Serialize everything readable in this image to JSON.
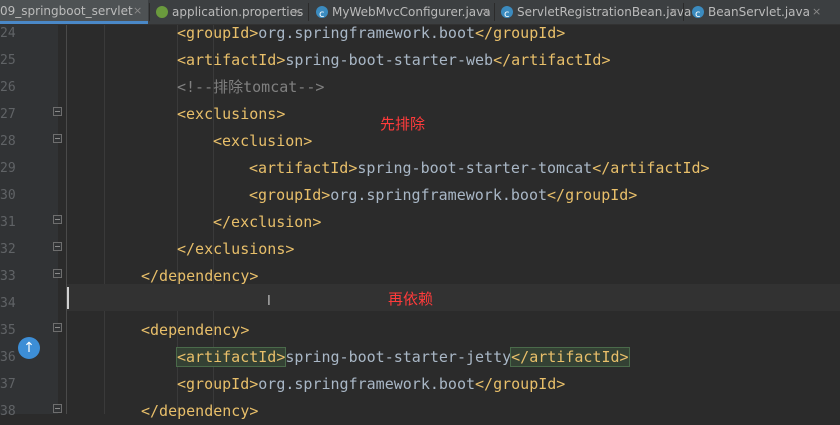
{
  "tabs": [
    {
      "label": "09_springboot_servlet",
      "icon": "module-icon",
      "active": true
    },
    {
      "label": "application.properties",
      "icon": "spring-leaf-icon"
    },
    {
      "label": "MyWebMvcConfigurer.java",
      "icon": "class-icon"
    },
    {
      "label": "ServletRegistrationBean.java",
      "icon": "class-icon"
    },
    {
      "label": "BeanServlet.java",
      "icon": "class-icon"
    }
  ],
  "close_glyph": "×",
  "gutter": {
    "line_numbers": [
      "24",
      "25",
      "26",
      "27",
      "28",
      "29",
      "30",
      "31",
      "32",
      "33",
      "34",
      "35",
      "36",
      "37",
      "38"
    ],
    "override_glyph": "↑"
  },
  "code": {
    "l24": {
      "open": "<groupId>",
      "text": "org.springframework.boot",
      "close": "</groupId>"
    },
    "l25": {
      "open": "<artifactId>",
      "text": "spring-boot-starter-web",
      "close": "</artifactId>"
    },
    "l26": {
      "comment": "<!--排除tomcat-->"
    },
    "l27": {
      "open": "<exclusions>"
    },
    "l28": {
      "open": "<exclusion>"
    },
    "l29": {
      "open": "<artifactId>",
      "text": "spring-boot-starter-tomcat",
      "close": "</artifactId>"
    },
    "l30": {
      "open": "<groupId>",
      "text": "org.springframework.boot",
      "close": "</groupId>"
    },
    "l31": {
      "close": "</exclusion>"
    },
    "l32": {
      "close": "</exclusions>"
    },
    "l33": {
      "close": "</dependency>"
    },
    "l35": {
      "open": "<dependency>"
    },
    "l36": {
      "open": "<artifactId>",
      "text": "spring-boot-starter-jetty",
      "close": "</artifactId>"
    },
    "l37": {
      "open": "<groupId>",
      "text": "org.springframework.boot",
      "close": "</groupId>"
    },
    "l38": {
      "close": "</dependency>"
    }
  },
  "annotations": {
    "exclude_first": "先排除",
    "then_depend": "再依赖"
  },
  "colors": {
    "tag": "#e8bf6a",
    "text": "#a9b7c6",
    "comment": "#808080",
    "annotation": "#ff3b3b",
    "accent": "#4a88c7"
  }
}
